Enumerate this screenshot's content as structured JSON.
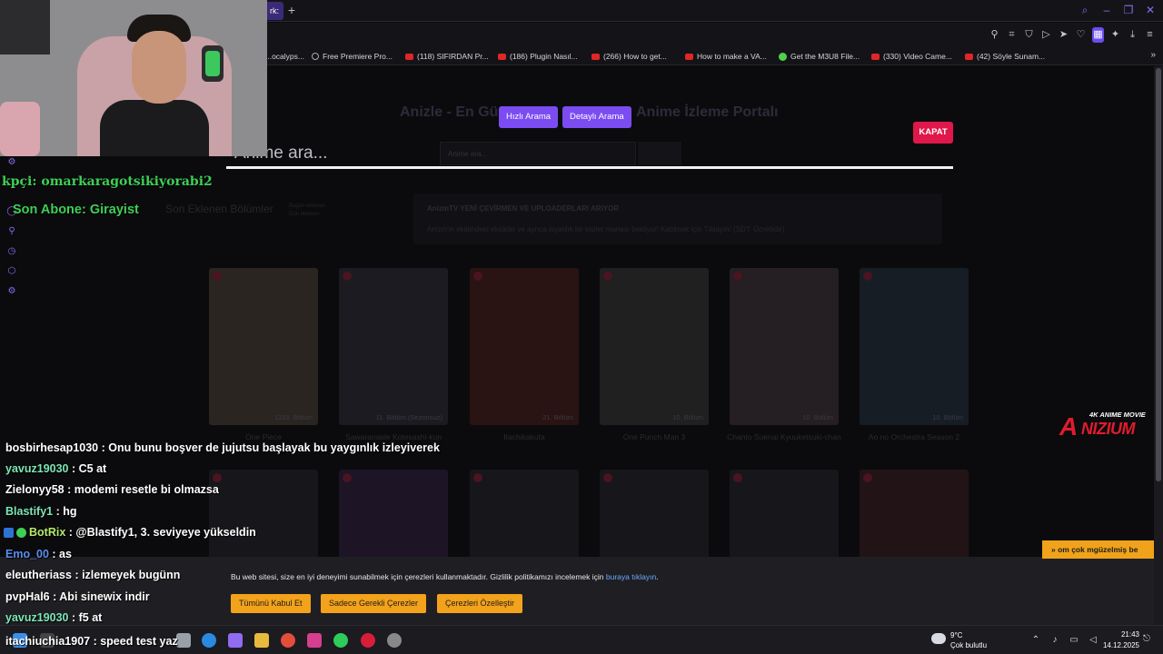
{
  "browser": {
    "active_tab_label": "rk:",
    "new_tab_icon": "plus-icon",
    "window_controls": [
      "search-icon",
      "minimize-icon",
      "restore-icon",
      "close-icon"
    ],
    "toolbar_icons": [
      "pin-icon",
      "crop-icon",
      "shield-icon",
      "play-icon",
      "send-icon",
      "heart-icon",
      "extension-active-icon",
      "puzzle-icon",
      "download-icon",
      "menu-icon"
    ]
  },
  "bookmarks": [
    {
      "icon": "globe",
      "label": "...ocalyps..."
    },
    {
      "icon": "globe",
      "label": "Free Premiere Pro..."
    },
    {
      "icon": "yt",
      "label": "(118) SIFIRDAN Pr..."
    },
    {
      "icon": "yt",
      "label": "(186) Plugin Nasıl..."
    },
    {
      "icon": "yt",
      "label": "(266) How to get..."
    },
    {
      "icon": "yt",
      "label": "How to make a VA..."
    },
    {
      "icon": "green",
      "label": "Get the M3U8 File..."
    },
    {
      "icon": "yt",
      "label": "(330) Video Came..."
    },
    {
      "icon": "yt",
      "label": "(42) Söyle Sunam..."
    }
  ],
  "page": {
    "hero_left": "Anizle - En Gü",
    "hero_right": "Anime İzleme Portalı",
    "bg_search_placeholder": "Anime ara...",
    "quick_search": "Hızlı Arama",
    "detailed_search": "Detaylı Arama",
    "close_label": "KAPAT",
    "search_overlay_placeholder": "Anime ara...",
    "section_title": "Son Eklenen Bölümler",
    "section_sub_1": "Bugün eklenen",
    "section_sub_2": "Dün eklenen",
    "notice_title": "AnizmTV YENİ ÇEVİRMEN VE UPLOADERLARI ARIYOR",
    "notice_body": "Anizm'in ekibindeki eksikler ve ayrıca isyanlık bir kişiler manası bekliyor! Katılmak için Tıklayın! (SDT: Ücretlidir)",
    "cards_row1": [
      {
        "title": "One Piece",
        "badge": "1153. Bölüm",
        "color": "#2a2520"
      },
      {
        "title": "Sawaranaide Kotesashi-kun",
        "badge": "11. Bölüm (Sezonsuz)",
        "color": "#1c1b22"
      },
      {
        "title": "Itachikakuta",
        "badge": "21. Bölüm",
        "color": "#2a1313"
      },
      {
        "title": "One Punch Man 3",
        "badge": "10. Bölüm",
        "color": "#202020"
      },
      {
        "title": "Chanto Suenai Kyuuketsuki-chan",
        "badge": "10. Bölüm",
        "color": "#251e22"
      },
      {
        "title": "Ao no Orchestra Season 2",
        "badge": "10. Bölüm",
        "color": "#171d25"
      }
    ],
    "cookie_text": "Bu web sitesi, size en iyi deneyimi sunabilmek için çerezleri kullanmaktadır. Gizlilik politikamızı incelemek için",
    "cookie_link": "buraya tıklayın",
    "cookie_accept": "Tümünü Kabul Et",
    "cookie_required": "Sadece Gerekli Çerezler",
    "cookie_customize": "Çerezleri Özelleştir",
    "popup_right": "» om çok mgüzelmiş be",
    "anizium_tag": "4K ANIME MOVIE",
    "anizium_logo": "NIZIUM",
    "anizium_mark": "A"
  },
  "stream": {
    "mod_line": "kpçi: omarkaragotsikiyorabi2",
    "sub_line": "Son Abone: Girayist",
    "chat": [
      {
        "user": "bosbirhesap1030",
        "color": "#ffffff",
        "msg": " : Onu bunu boşver de jujutsu başlayak bu yaygınlık izleyiverek",
        "badges": false
      },
      {
        "user": "yavuz19030",
        "color": "#7ce6b5",
        "msg": " : C5 at",
        "badges": false
      },
      {
        "user": "Zielonyy58",
        "color": "#ffffff",
        "msg": " : modemi resetle bi olmazsa",
        "badges": false
      },
      {
        "user": "Blastify1",
        "color": "#7ce6b5",
        "msg": " : hg",
        "badges": false
      },
      {
        "user": "BotRix",
        "color": "#b6e86a",
        "msg": " : @Blastify1, 3. seviyeye yükseldin",
        "badges": true
      },
      {
        "user": "Emo_00",
        "color": "#5a8ef0",
        "msg": " : as",
        "badges": false
      },
      {
        "user": "eleutheriass",
        "color": "#ffffff",
        "msg": " : izlemeyek bugünn",
        "badges": false
      },
      {
        "user": "pvpHal6",
        "color": "#ffffff",
        "msg": " : Abi sinewix indir",
        "badges": false
      },
      {
        "user": "yavuz19030",
        "color": "#7ce6b5",
        "msg": " : f5 at",
        "badges": false
      },
      {
        "user": "itachiuchia1907",
        "color": "#ffffff",
        "msg": " : speed test yaz",
        "badges": false
      }
    ]
  },
  "taskbar": {
    "temp": "9°C",
    "weather_desc": "Çok bulutlu",
    "time": "21:43",
    "date": "14.12.2025"
  }
}
